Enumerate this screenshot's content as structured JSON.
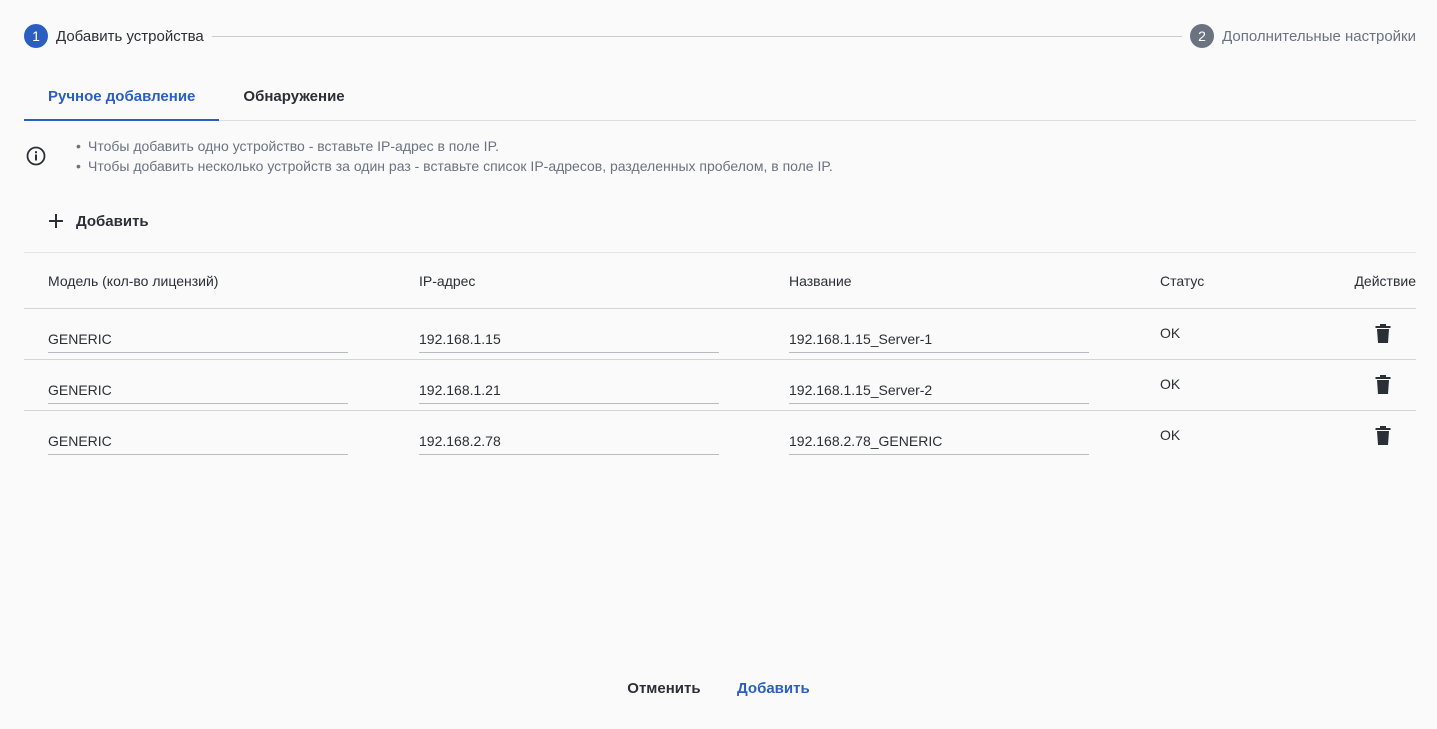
{
  "stepper": {
    "step1": {
      "number": "1",
      "label": "Добавить устройства"
    },
    "step2": {
      "number": "2",
      "label": "Дополнительные настройки"
    }
  },
  "tabs": [
    {
      "label": "Ручное добавление",
      "active": true
    },
    {
      "label": "Обнаружение",
      "active": false
    }
  ],
  "info": {
    "icon": "info-icon",
    "lines": [
      "Чтобы добавить одно устройство - вставьте IP-адрес в поле IP.",
      "Чтобы добавить несколько устройств за один раз - вставьте список IP-адресов, разделенных пробелом, в поле IP."
    ]
  },
  "add_button": {
    "icon": "plus-icon",
    "label": "Добавить"
  },
  "table": {
    "headers": [
      "Модель (кол-во лицензий)",
      "IP-адрес",
      "Название",
      "Статус",
      "Действие"
    ],
    "rows": [
      {
        "model": "GENERIC",
        "ip": "192.168.1.15",
        "name": "192.168.1.15_Server-1",
        "status": "OK",
        "action_icon": "trash-icon"
      },
      {
        "model": "GENERIC",
        "ip": "192.168.1.21",
        "name": "192.168.1.15_Server-2",
        "status": "OK",
        "action_icon": "trash-icon"
      },
      {
        "model": "GENERIC",
        "ip": "192.168.2.78",
        "name": "192.168.2.78_GENERIC",
        "status": "OK",
        "action_icon": "trash-icon"
      }
    ]
  },
  "footer": {
    "cancel_label": "Отменить",
    "add_label": "Добавить"
  },
  "colors": {
    "accent": "#2a5fc1",
    "muted": "#6b7280",
    "text": "#2b2f36"
  }
}
